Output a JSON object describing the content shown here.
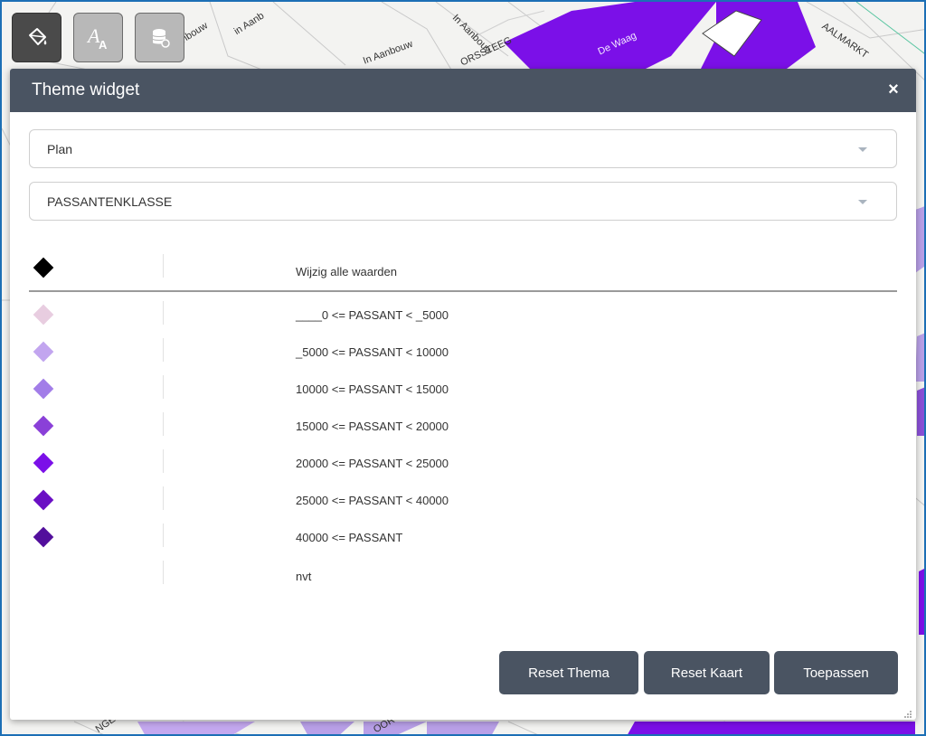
{
  "map": {
    "street_labels": [
      "In Aanbouw",
      "In Aanbouw",
      "in Aanb",
      "In Aanbouw",
      "ORSSTEEG",
      "De Waag",
      "AALMARKT",
      "NGE",
      "OOR"
    ]
  },
  "toolbar": {
    "buttons": [
      {
        "icon": "paint-bucket-icon",
        "active": true
      },
      {
        "icon": "font-style-icon",
        "active": false
      },
      {
        "icon": "database-icon",
        "active": false
      }
    ]
  },
  "widget": {
    "title": "Theme widget",
    "close_label": "×",
    "layer_select": {
      "value": "Plan"
    },
    "field_select": {
      "value": "PASSANTENKLASSE"
    },
    "legend": {
      "header": {
        "label": "Wijzig alle waarden",
        "color": "#000000"
      },
      "items": [
        {
          "label": "____0 <= PASSANT < _5000",
          "color": "#e8cde0"
        },
        {
          "label": "_5000 <= PASSANT < 10000",
          "color": "#c2a5ef"
        },
        {
          "label": "10000 <= PASSANT < 15000",
          "color": "#a27de8"
        },
        {
          "label": "15000 <= PASSANT < 20000",
          "color": "#8a40d8"
        },
        {
          "label": "20000 <= PASSANT < 25000",
          "color": "#7b10e8"
        },
        {
          "label": "25000 <= PASSANT < 40000",
          "color": "#6a0fc4"
        },
        {
          "label": "40000 <= PASSANT",
          "color": "#520f9c"
        },
        {
          "label": "nvt",
          "color": ""
        }
      ]
    },
    "buttons": {
      "reset_theme": "Reset Thema",
      "reset_map": "Reset Kaart",
      "apply": "Toepassen"
    }
  },
  "colors": {
    "header_bg": "#4a5462",
    "map_purple": "#7b10e8",
    "map_light_purple": "#b9a0e8"
  }
}
